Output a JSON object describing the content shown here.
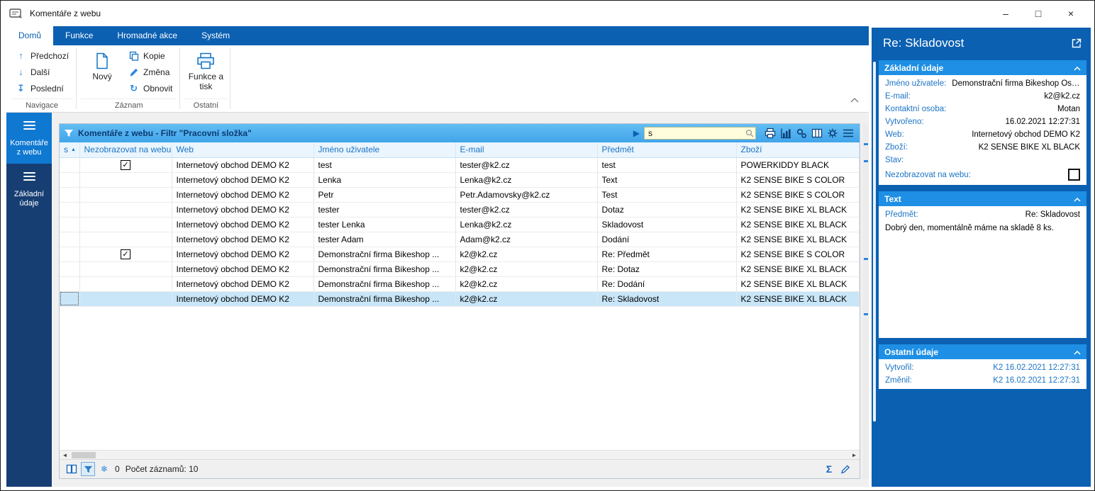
{
  "window": {
    "title": "Komentáře z webu",
    "minimize": "–",
    "maximize": "□",
    "close": "×"
  },
  "ribbon": {
    "tabs": [
      {
        "label": "Domů",
        "active": true
      },
      {
        "label": "Funkce",
        "active": false
      },
      {
        "label": "Hromadné akce",
        "active": false
      },
      {
        "label": "Systém",
        "active": false
      }
    ],
    "groups": [
      {
        "label": "Navigace",
        "items": [
          "Předchozí",
          "Další",
          "Poslední"
        ]
      },
      {
        "label": "Záznam",
        "items": [
          "Nový",
          "Kopie",
          "Změna",
          "Obnovit"
        ]
      },
      {
        "label": "Ostatní",
        "items": [
          "Funkce a tisk"
        ]
      }
    ]
  },
  "sidebar": {
    "items": [
      {
        "label": "Komentáře z webu",
        "active": true
      },
      {
        "label": "Základní údaje",
        "active": false
      }
    ]
  },
  "grid": {
    "title": "Komentáře z webu - Filtr \"Pracovní složka\"",
    "search_value": "s",
    "sort_indicator": "▲",
    "toolbar_icons": [
      "play",
      "print",
      "chart",
      "automation",
      "columns",
      "settings",
      "menu"
    ],
    "columns": [
      "s",
      "Nezobrazovat na webu",
      "Web",
      "Jméno uživatele",
      "E-mail",
      "Předmět",
      "Zboží"
    ],
    "rows": [
      {
        "checked": true,
        "selected": false,
        "web": "Internetový obchod DEMO K2",
        "user": "test",
        "email": "tester@k2.cz",
        "subject": "test",
        "goods": "POWERKIDDY BLACK"
      },
      {
        "checked": false,
        "selected": false,
        "web": "Internetový obchod DEMO K2",
        "user": "Lenka",
        "email": "Lenka@k2.cz",
        "subject": "Text",
        "goods": "K2 SENSE BIKE S COLOR"
      },
      {
        "checked": false,
        "selected": false,
        "web": "Internetový obchod DEMO K2",
        "user": "Petr",
        "email": "Petr.Adamovsky@k2.cz",
        "subject": "Test",
        "goods": "K2 SENSE BIKE S COLOR"
      },
      {
        "checked": false,
        "selected": false,
        "web": "Internetový obchod DEMO K2",
        "user": "tester",
        "email": "tester@k2.cz",
        "subject": "Dotaz",
        "goods": "K2 SENSE BIKE XL BLACK"
      },
      {
        "checked": false,
        "selected": false,
        "web": "Internetový obchod DEMO K2",
        "user": "tester Lenka",
        "email": "Lenka@k2.cz",
        "subject": "Skladovost",
        "goods": "K2 SENSE BIKE XL BLACK"
      },
      {
        "checked": false,
        "selected": false,
        "web": "Internetový obchod DEMO K2",
        "user": "tester Adam",
        "email": "Adam@k2.cz",
        "subject": "Dodání",
        "goods": "K2 SENSE BIKE XL BLACK"
      },
      {
        "checked": true,
        "selected": false,
        "web": "Internetový obchod DEMO K2",
        "user": "Demonstrační firma Bikeshop ...",
        "email": "k2@k2.cz",
        "subject": "Re: Předmět",
        "goods": "K2 SENSE BIKE S COLOR"
      },
      {
        "checked": false,
        "selected": false,
        "web": "Internetový obchod DEMO K2",
        "user": "Demonstrační firma Bikeshop ...",
        "email": "k2@k2.cz",
        "subject": "Re: Dotaz",
        "goods": "K2 SENSE BIKE XL BLACK"
      },
      {
        "checked": false,
        "selected": false,
        "web": "Internetový obchod DEMO K2",
        "user": "Demonstrační firma Bikeshop ...",
        "email": "k2@k2.cz",
        "subject": "Re: Dodání",
        "goods": "K2 SENSE BIKE XL BLACK"
      },
      {
        "checked": false,
        "selected": true,
        "web": "Internetový obchod DEMO K2",
        "user": "Demonstrační firma Bikeshop ...",
        "email": "k2@k2.cz",
        "subject": "Re: Skladovost",
        "goods": "K2 SENSE BIKE XL BLACK"
      }
    ]
  },
  "statusbar": {
    "frozen_count": "0",
    "records_label": "Počet záznamů: 10",
    "sum_icon": "Σ"
  },
  "detail": {
    "title": "Re: Skladovost",
    "sections": [
      {
        "title": "Základní údaje",
        "fields": [
          {
            "label": "Jméno uživatele:",
            "value": "Demonstrační firma Bikeshop Ostr..."
          },
          {
            "label": "E-mail:",
            "value": "k2@k2.cz"
          },
          {
            "label": "Kontaktní osoba:",
            "value": "Motan"
          },
          {
            "label": "Vytvořeno:",
            "value": "16.02.2021 12:27:31"
          },
          {
            "label": "Web:",
            "value": "Internetový obchod DEMO K2"
          },
          {
            "label": "Zboží:",
            "value": "K2 SENSE BIKE XL BLACK"
          },
          {
            "label": "Stav:",
            "value": ""
          },
          {
            "label": "Nezobrazovat na webu:",
            "checkbox": true,
            "checked": false
          }
        ]
      },
      {
        "title": "Text",
        "fields": [
          {
            "label": "Předmět:",
            "value": "Re: Skladovost"
          }
        ],
        "body_text": "Dobrý den, momentálně máme na skladě 8 ks."
      },
      {
        "title": "Ostatní údaje",
        "fields": [
          {
            "label": "Vytvořil:",
            "value": "K2 16.02.2021 12:27:31"
          },
          {
            "label": "Změnil:",
            "value": "K2 16.02.2021 12:27:31"
          }
        ]
      }
    ]
  },
  "colors": {
    "accent_blue": "#0B60B2",
    "light_blue_bar": "#4FB0ED",
    "section_header_blue": "#1E8FE4",
    "selected_row": "#C8E6F8",
    "link_blue": "#1B74C5"
  }
}
